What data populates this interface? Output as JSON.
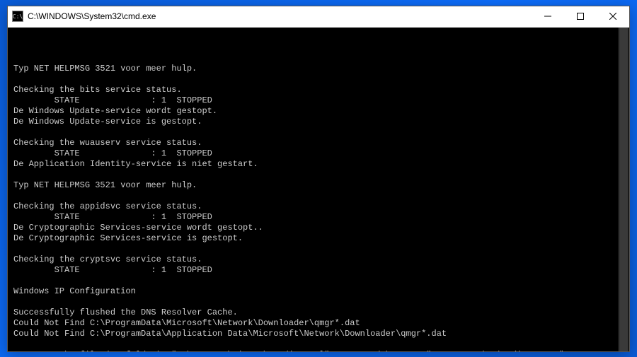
{
  "window": {
    "title": "C:\\WINDOWS\\System32\\cmd.exe",
    "icon_label": "cmd-icon"
  },
  "terminal": {
    "lines": [
      "",
      "Typ NET HELPMSG 3521 voor meer hulp.",
      "",
      "Checking the bits service status.",
      "        STATE              : 1  STOPPED",
      "De Windows Update-service wordt gestopt.",
      "De Windows Update-service is gestopt.",
      "",
      "Checking the wuauserv service status.",
      "        STATE              : 1  STOPPED",
      "De Application Identity-service is niet gestart.",
      "",
      "Typ NET HELPMSG 3521 voor meer hulp.",
      "",
      "Checking the appidsvc service status.",
      "        STATE              : 1  STOPPED",
      "De Cryptographic Services-service wordt gestopt..",
      "De Cryptographic Services-service is gestopt.",
      "",
      "Checking the cryptsvc service status.",
      "        STATE              : 1  STOPPED",
      "",
      "Windows IP Configuration",
      "",
      "Successfully flushed the DNS Resolver Cache.",
      "Could Not Find C:\\ProgramData\\Microsoft\\Network\\Downloader\\qmgr*.dat",
      "Could Not Find C:\\ProgramData\\Application Data\\Microsoft\\Network\\Downloader\\qmgr*.dat",
      "",
      "SUCCESS: The file (or folder): \"C:\\WINDOWS\\winsxs\\pending.xml\" now owned by user \"STEFAN7C5E\\Gebruikersnaam\"."
    ]
  }
}
